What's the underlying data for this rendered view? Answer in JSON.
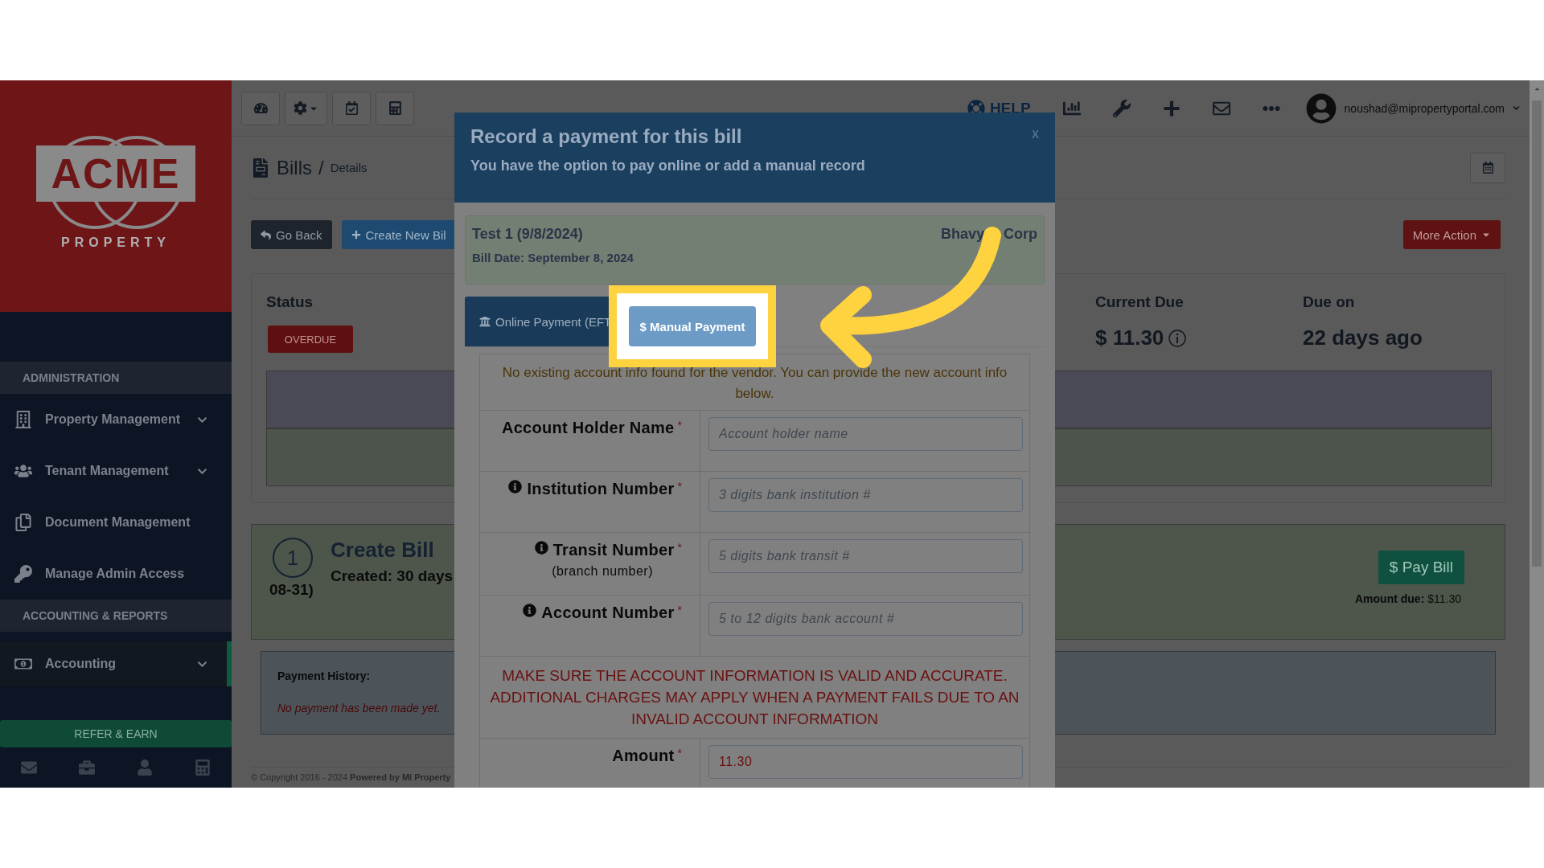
{
  "sidebar": {
    "logo": {
      "wordmark": "ACME",
      "tagline": "PROPERTY"
    },
    "sections": [
      {
        "heading": "ADMINISTRATION",
        "items": [
          {
            "label": "Property Management",
            "kind": "building",
            "expandable": true,
            "selected": false
          },
          {
            "label": "Tenant Management",
            "kind": "users",
            "expandable": true,
            "selected": false
          },
          {
            "label": "Document Management",
            "kind": "documents",
            "expandable": false,
            "selected": false
          },
          {
            "label": "Manage Admin Access",
            "kind": "key",
            "expandable": false,
            "selected": false
          }
        ]
      },
      {
        "heading": "ACCOUNTING & REPORTS",
        "items": [
          {
            "label": "Accounting",
            "kind": "money",
            "expandable": true,
            "selected": true
          }
        ]
      }
    ],
    "refer_button": "REFER & EARN",
    "footer_icons": [
      {
        "kind": "mail"
      },
      {
        "kind": "briefcase"
      },
      {
        "kind": "user"
      },
      {
        "kind": "calculator"
      }
    ]
  },
  "topbar": {
    "tools": [
      {
        "kind": "dashboard"
      },
      {
        "kind": "settings"
      },
      {
        "kind": "calendar"
      },
      {
        "kind": "calculator"
      }
    ],
    "help": "HELP",
    "icons": [
      {
        "kind": "chart"
      },
      {
        "kind": "wrench"
      },
      {
        "kind": "plus"
      },
      {
        "kind": "mail"
      },
      {
        "kind": "more"
      }
    ],
    "user": "noushad@mipropertyportal.com"
  },
  "page": {
    "breadcrumb": {
      "title": "Bills",
      "separator": "/",
      "current": "Details"
    },
    "actions": {
      "back": "Go Back",
      "create": "Create New Bil",
      "more": "More Action"
    },
    "status": {
      "label": "Status",
      "badge": "OVERDUE",
      "current_due_label": "Current Due",
      "current_due": "$ 11.30",
      "due_on_label": "Due on",
      "due_on": "22 days ago"
    },
    "timeline": {
      "step": "1",
      "title": "Create Bill",
      "created": "Created: 30 days",
      "date_tail": "08-31)",
      "pay_button": "$ Pay Bill",
      "amount_due": "**Amount due:** $11.30"
    },
    "payment_history": {
      "label": "Payment History:",
      "empty": "No payment has been made yet."
    },
    "footer": "© Copyright 2016 - 2024 **Powered by MI Property**"
  },
  "modal": {
    "title": "Record a payment for this bill",
    "subtitle": "You have the option to pay online or add a manual record",
    "close": "x",
    "bill": {
      "name": "Test 1 (9/8/2024)",
      "vendor_parts": [
        "Bhavy",
        "Corp"
      ],
      "date": "Bill Date: September 8, 2024"
    },
    "tabs": [
      {
        "label": "Online Payment (EFT",
        "kind": "online",
        "selected": true
      },
      {
        "label": "$ Manual Payment",
        "kind": "manual",
        "selected": false
      }
    ],
    "notice": "No existing account info found for the vendor. You can provide the new account info below.",
    "fields": [
      {
        "label": "Account Holder Name",
        "info": false,
        "required": true,
        "mark": "*",
        "placeholder": "Account holder name"
      },
      {
        "label": "Institution Number",
        "info": true,
        "required": true,
        "mark": "*",
        "placeholder": "3 digits bank institution #"
      },
      {
        "label": "Transit Number",
        "note": "(branch number)",
        "info": true,
        "required": true,
        "mark": "*",
        "placeholder": "5 digits bank transit #"
      },
      {
        "label": "Account Number",
        "info": true,
        "required": true,
        "mark": "*",
        "placeholder": "5 to 12 digits bank account #"
      }
    ],
    "warning": "MAKE SURE THE ACCOUNT INFORMATION IS VALID AND ACCURATE. ADDITIONAL CHARGES MAY APPLY WHEN A PAYMENT FAILS DUE TO AN INVALID ACCOUNT INFORMATION",
    "amount": {
      "label": "Amount",
      "required": true,
      "mark": "*",
      "value": "11.30"
    }
  }
}
